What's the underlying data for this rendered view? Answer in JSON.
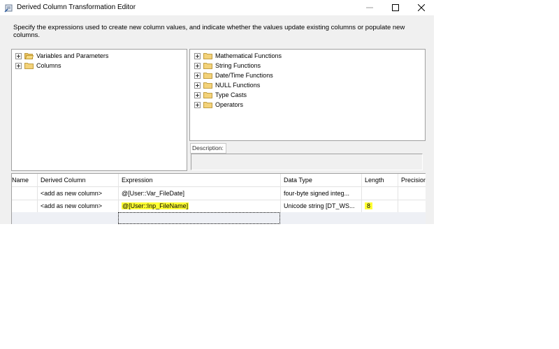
{
  "window": {
    "title": "Derived Column Transformation Editor"
  },
  "description": "Specify the expressions used to create new column values, and indicate whether the values update existing columns or populate new columns.",
  "left_tree": [
    {
      "label": "Variables and Parameters",
      "icon": "folder-open-icon"
    },
    {
      "label": "Columns",
      "icon": "folder-icon"
    }
  ],
  "right_tree": [
    {
      "label": "Mathematical Functions"
    },
    {
      "label": "String Functions"
    },
    {
      "label": "Date/Time Functions"
    },
    {
      "label": "NULL Functions"
    },
    {
      "label": "Type Casts"
    },
    {
      "label": "Operators"
    }
  ],
  "description_label": "Description:",
  "grid": {
    "headers": [
      "Name",
      "Derived Column",
      "Expression",
      "Data Type",
      "Length",
      "Precision"
    ],
    "rows": [
      [
        "",
        "<add as new column>",
        "@[User::Var_FileDate]",
        "four-byte signed integ...",
        "",
        ""
      ],
      [
        "",
        "<add as new column>",
        "@[User::Inp_FileName]",
        "Unicode string [DT_WS...",
        "8",
        ""
      ]
    ]
  },
  "colors": {
    "highlight": "#ffff33",
    "window_bg": "#f0f0f0"
  }
}
